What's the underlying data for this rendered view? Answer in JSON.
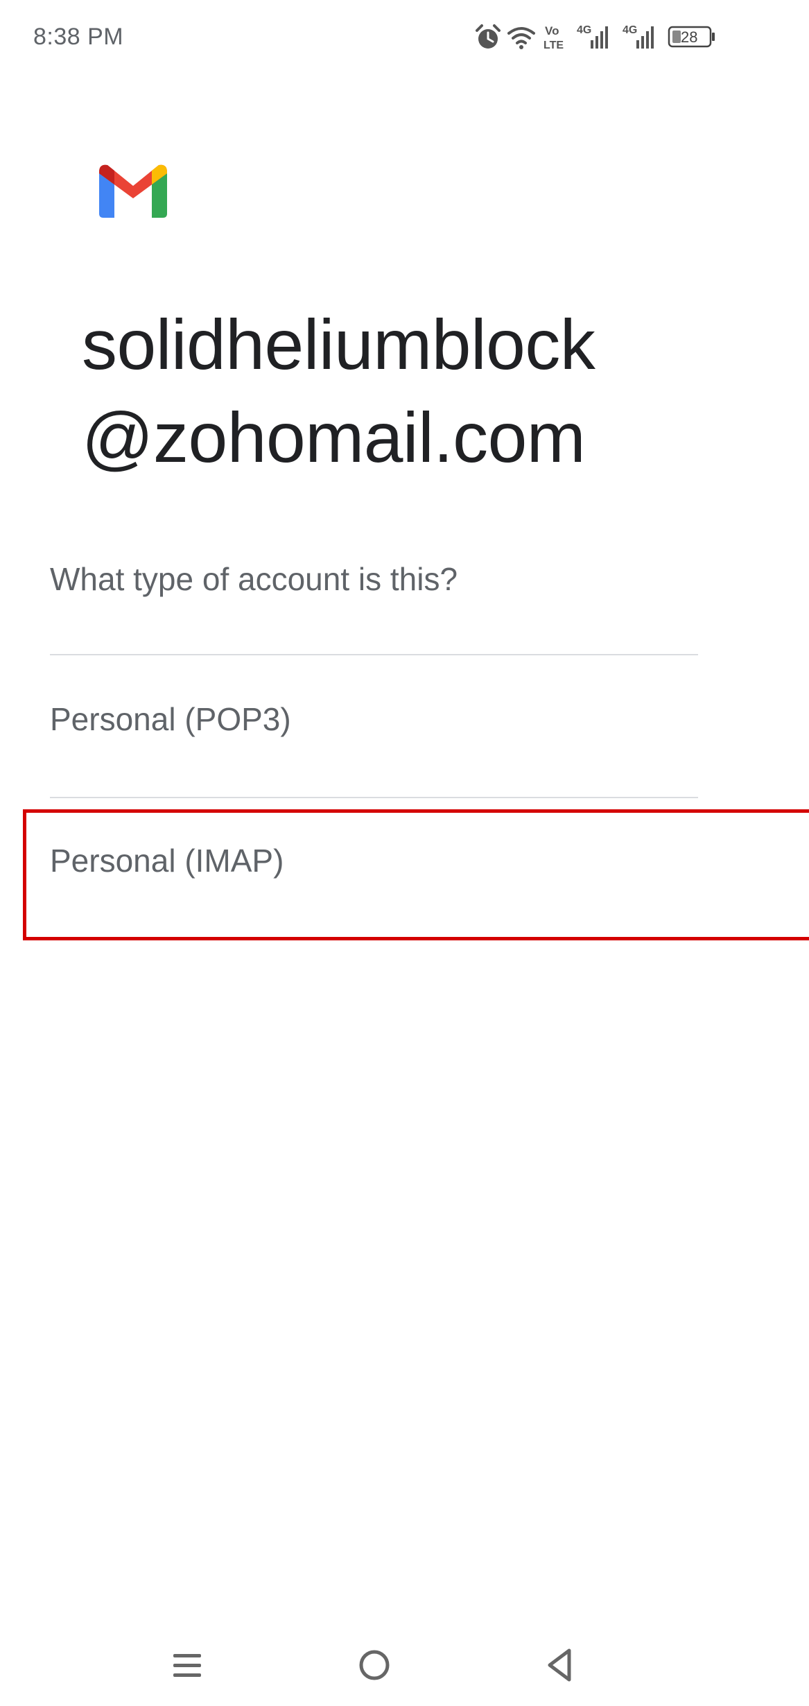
{
  "status_bar": {
    "time": "8:38 PM",
    "battery_level": "28",
    "volte_label_top": "Vo",
    "volte_label_bottom": "LTE",
    "network_1": "4G",
    "network_2": "4G",
    "icons": [
      "alarm-icon",
      "wifi-icon",
      "volte-icon",
      "signal-icon",
      "signal-icon",
      "battery-icon"
    ]
  },
  "app": {
    "logo": "gmail-logo",
    "logo_colors": {
      "blue": "#4285F4",
      "red": "#EA4335",
      "yellow": "#FBBC04",
      "green": "#34A853",
      "dark_red": "#C5221F"
    }
  },
  "account": {
    "email_line_1": "solidheliumblock",
    "email_line_2": "@zohomail.com"
  },
  "account_type": {
    "prompt": "What type of account is this?",
    "options": [
      {
        "label": "Personal (POP3)"
      },
      {
        "label": "Personal (IMAP)",
        "highlighted": true
      }
    ],
    "highlight_color": "#D40000"
  },
  "nav_bar": {
    "buttons": [
      "menu-icon",
      "home-icon",
      "back-icon"
    ]
  }
}
